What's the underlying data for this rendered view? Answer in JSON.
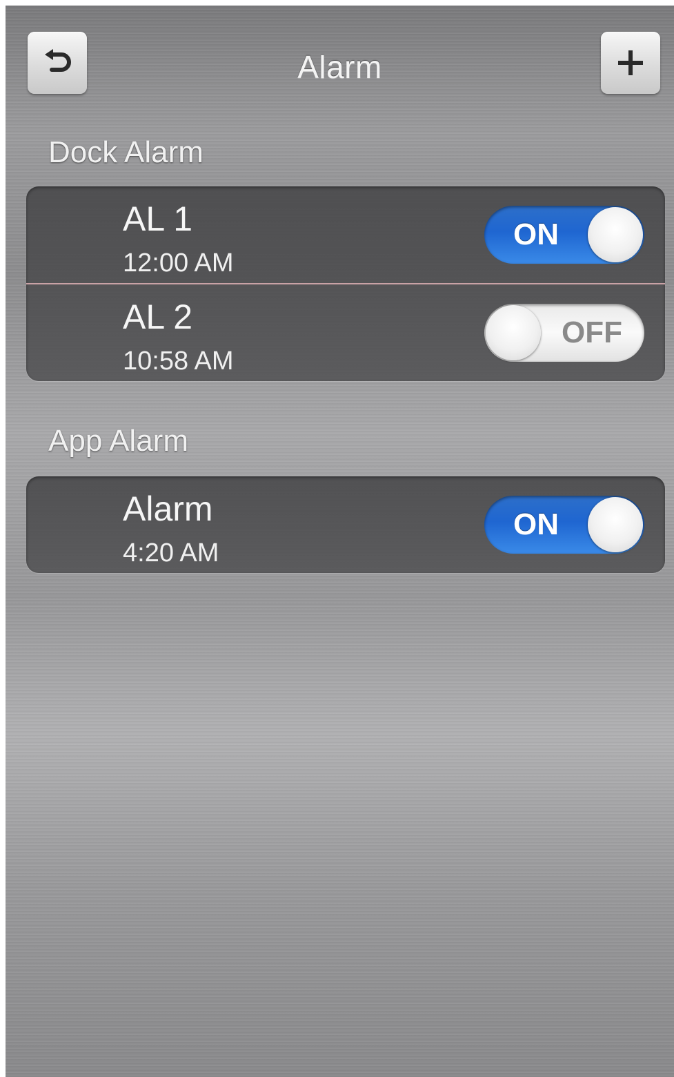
{
  "header": {
    "title": "Alarm",
    "back_icon": "undo-arrow-icon",
    "add_icon": "plus-icon"
  },
  "sections": [
    {
      "header": "Dock Alarm",
      "items": [
        {
          "name": "AL 1",
          "time": "12:00 AM",
          "toggle": "ON"
        },
        {
          "name": "AL 2",
          "time": "10:58 AM",
          "toggle": "OFF"
        }
      ]
    },
    {
      "header": "App Alarm",
      "items": [
        {
          "name": "Alarm",
          "time": "4:20 AM",
          "toggle": "ON"
        }
      ]
    }
  ],
  "colors": {
    "toggle_on": "#1f66d1",
    "toggle_off": "#f2f2f2",
    "group_background": "#4a4a4c"
  }
}
